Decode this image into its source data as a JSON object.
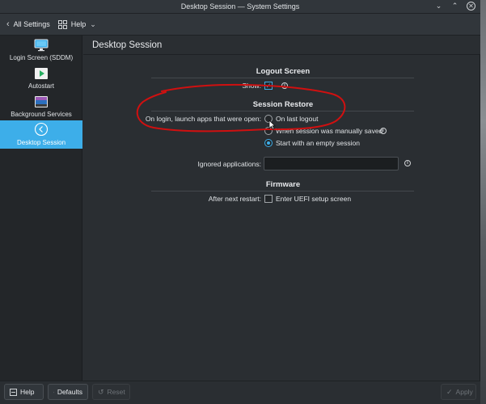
{
  "window": {
    "title": "Desktop Session — System Settings",
    "controls": {
      "minimize": "chevron-down-icon",
      "maximize": "chevron-up-icon",
      "close": "close-icon"
    }
  },
  "toolbar": {
    "back_label": "All Settings",
    "help_label": "Help"
  },
  "sidebar": {
    "items": [
      {
        "label": "Login Screen (SDDM)",
        "icon": "monitor-icon"
      },
      {
        "label": "Autostart",
        "icon": "autostart-icon"
      },
      {
        "label": "Background Services",
        "icon": "background-services-icon"
      },
      {
        "label": "Desktop Session",
        "icon": "back-arrow-icon",
        "active": true
      }
    ]
  },
  "page": {
    "title": "Desktop Session"
  },
  "logout_screen": {
    "heading": "Logout Screen",
    "show_label": "Show:",
    "show_checked": true
  },
  "session_restore": {
    "heading": "Session Restore",
    "launch_label": "On login, launch apps that were open:",
    "options": [
      {
        "label": "On last logout",
        "checked": false
      },
      {
        "label": "When session was manually saved",
        "checked": false
      },
      {
        "label": "Start with an empty session",
        "checked": true
      }
    ],
    "ignored_label": "Ignored applications:",
    "ignored_value": ""
  },
  "firmware": {
    "heading": "Firmware",
    "restart_label": "After next restart:",
    "uefi_label": "Enter UEFI setup screen",
    "uefi_checked": false
  },
  "footer": {
    "help_label": "Help",
    "defaults_label": "Defaults",
    "reset_label": "Reset",
    "apply_label": "Apply"
  },
  "colors": {
    "accent": "#3daee9",
    "annotation": "#d01010",
    "background": "#2a2e32",
    "sidebar": "#232629"
  }
}
